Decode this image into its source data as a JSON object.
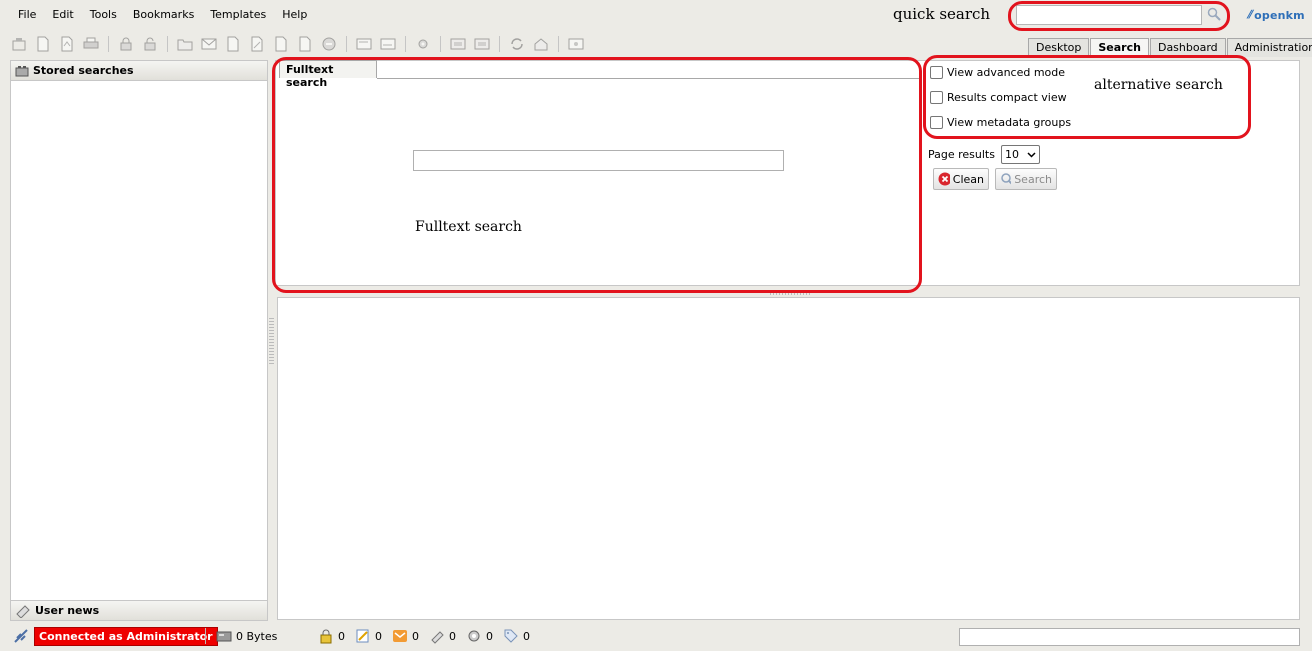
{
  "menu": [
    "File",
    "Edit",
    "Tools",
    "Bookmarks",
    "Templates",
    "Help"
  ],
  "quick_search": {
    "label": "quick search",
    "placeholder": ""
  },
  "logo": {
    "text": "openkm"
  },
  "tabs": [
    {
      "label": "Desktop",
      "active": false
    },
    {
      "label": "Search",
      "active": true
    },
    {
      "label": "Dashboard",
      "active": false
    },
    {
      "label": "Administration",
      "active": false
    }
  ],
  "left_panel": {
    "stored_searches": "Stored searches",
    "user_news": "User news"
  },
  "fulltext": {
    "tab_label": "Fulltext search",
    "caption": "Fulltext search",
    "value": ""
  },
  "options": {
    "advanced_mode": "View advanced mode",
    "compact_view": "Results compact view",
    "metadata_groups": "View metadata groups",
    "caption": "alternative search",
    "page_results_label": "Page results",
    "page_results_value": "10",
    "clean_button": "Clean",
    "search_button": "Search"
  },
  "status": {
    "connected": "Connected as Administrator",
    "size": "0 Bytes",
    "counts": [
      "0",
      "0",
      "0",
      "0",
      "0",
      "0"
    ]
  },
  "colors": {
    "annotation": "#e2131d",
    "connected_bg": "#ee0000",
    "logo": "#2e6fb8"
  }
}
